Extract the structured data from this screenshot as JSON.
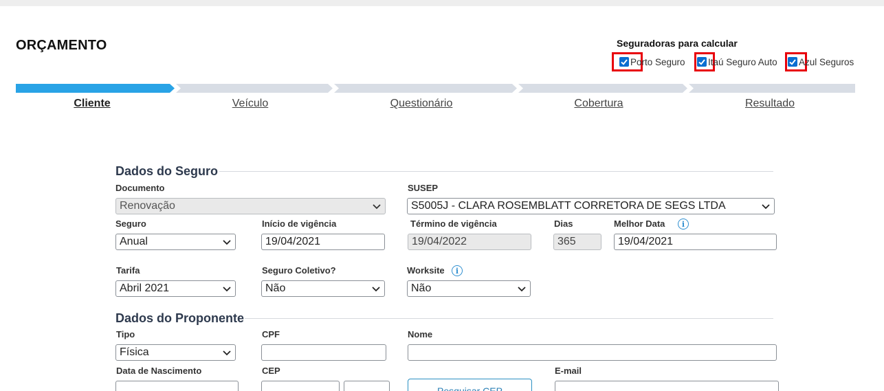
{
  "page": {
    "title": "ORÇAMENTO"
  },
  "insurers": {
    "title": "Seguradoras para calcular",
    "items": [
      {
        "label": "Porto Seguro",
        "checked": true
      },
      {
        "label": "Itaú Seguro Auto",
        "checked": true
      },
      {
        "label": "Azul Seguros",
        "checked": true
      }
    ],
    "highlight_color": "#e8000b"
  },
  "steps": {
    "active_color": "#29a3e6",
    "inactive_color": "#d8dde5",
    "items": [
      {
        "label": "Cliente",
        "active": true
      },
      {
        "label": "Veículo",
        "active": false
      },
      {
        "label": "Questionário",
        "active": false
      },
      {
        "label": "Cobertura",
        "active": false
      },
      {
        "label": "Resultado",
        "active": false
      }
    ]
  },
  "dados_seguro": {
    "title": "Dados do Seguro",
    "documento": {
      "label": "Documento",
      "value": "Renovação"
    },
    "susep": {
      "label": "SUSEP",
      "value": "S5005J - CLARA ROSEMBLATT CORRETORA DE SEGS LTDA"
    },
    "seguro": {
      "label": "Seguro",
      "value": "Anual"
    },
    "inicio_vigencia": {
      "label": "Início de vigência",
      "value": "19/04/2021"
    },
    "termino_vigencia": {
      "label": "Término de vigência",
      "value": "19/04/2022"
    },
    "dias": {
      "label": "Dias",
      "value": "365"
    },
    "melhor_data": {
      "label": "Melhor Data",
      "value": "19/04/2021"
    },
    "tarifa": {
      "label": "Tarifa",
      "value": "Abril 2021"
    },
    "seguro_coletivo": {
      "label": "Seguro Coletivo?",
      "value": "Não"
    },
    "worksite": {
      "label": "Worksite",
      "value": "Não"
    }
  },
  "dados_proponente": {
    "title": "Dados do Proponente",
    "tipo": {
      "label": "Tipo",
      "value": "Física"
    },
    "cpf": {
      "label": "CPF",
      "value": ""
    },
    "nome": {
      "label": "Nome",
      "value": ""
    },
    "data_nascimento": {
      "label": "Data de Nascimento",
      "value": ""
    },
    "cep": {
      "label": "CEP",
      "value": ""
    },
    "pesquisar_cep": "Pesquisar CEP",
    "email": {
      "label": "E-mail",
      "value": ""
    }
  },
  "icons": {
    "info": "i"
  }
}
